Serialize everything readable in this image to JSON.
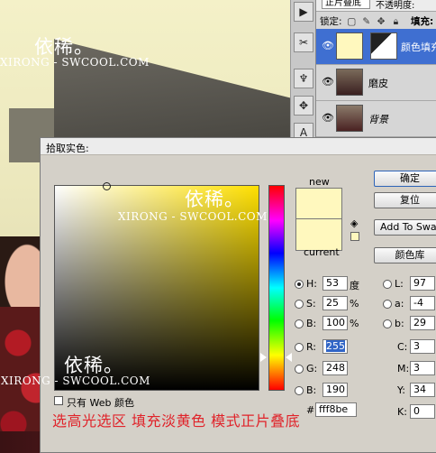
{
  "watermark": {
    "cn": "依稀。",
    "en": "XIRONG - SWCOOL.COM"
  },
  "layers": {
    "blend_mode": "正片叠底",
    "opacity_label": "不透明度:",
    "lock_label": "锁定:",
    "fill_label": "填充:",
    "items": [
      {
        "name": "颜色填充",
        "selected": true
      },
      {
        "name": "磨皮",
        "selected": false
      },
      {
        "name": "背景",
        "selected": false
      }
    ]
  },
  "dialog": {
    "title": "拾取实色:",
    "new_label": "new",
    "current_label": "current",
    "new_color": "#fff8be",
    "current_color": "#fff8be",
    "buttons": {
      "ok": "确定",
      "reset": "复位",
      "add_swatch": "Add To Swatches",
      "color_library": "颜色库"
    },
    "hsb": {
      "h_label": "H:",
      "h_value": "53",
      "h_unit": "度",
      "s_label": "S:",
      "s_value": "25",
      "s_unit": "%",
      "b_label": "B:",
      "b_value": "100",
      "b_unit": "%"
    },
    "rgb": {
      "r_label": "R:",
      "r_value": "255",
      "g_label": "G:",
      "g_value": "248",
      "b_label": "B:",
      "b_value": "190"
    },
    "lab": {
      "l_label": "L:",
      "l_value": "97",
      "a_label": "a:",
      "a_value": "-4",
      "b_label": "b:",
      "b_value": "29"
    },
    "cmyk": {
      "c_label": "C:",
      "c_value": "3",
      "m_label": "M:",
      "m_value": "3",
      "y_label": "Y:",
      "y_value": "34",
      "k_label": "K:",
      "k_value": "0"
    },
    "hex_value": "fff8be",
    "web_only_label": "只有 Web 颜色"
  },
  "caption": "选高光选区  填充淡黄色   模式正片叠底",
  "colors": {
    "accent_selected_layer": "#3f6fd1",
    "caption_red": "#e0232a"
  }
}
